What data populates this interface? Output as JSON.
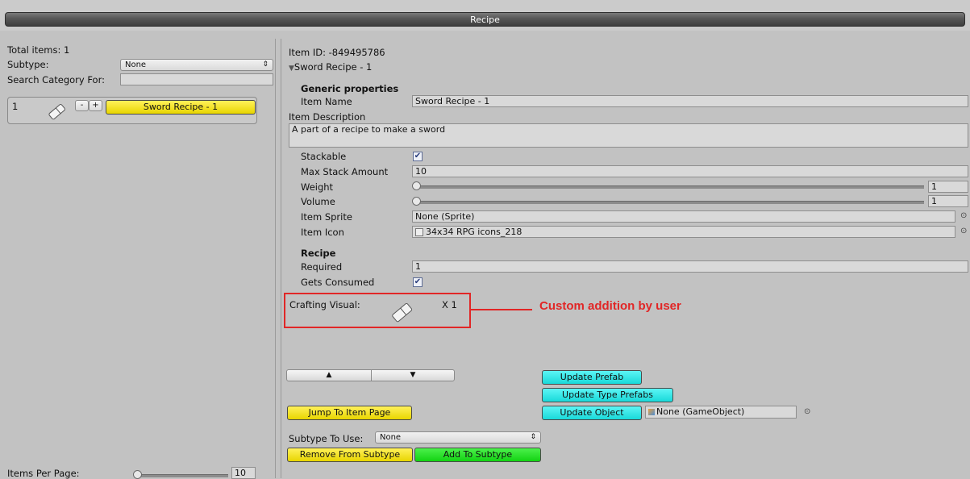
{
  "window": {
    "title": "Recipe"
  },
  "left": {
    "total_items": "Total items: 1",
    "subtype_label": "Subtype:",
    "subtype_value": "None",
    "search_label": "Search Category For:",
    "search_value": "",
    "item": {
      "index": "1",
      "minus": "-",
      "plus": "+",
      "name": "Sword Recipe - 1"
    },
    "items_per_page_label": "Items Per Page:",
    "items_per_page_value": "10",
    "items_per_page_fraction": 0.0
  },
  "right": {
    "item_id": "Item ID: -849495786",
    "foldout": "Sword Recipe - 1",
    "generic_header": "Generic properties",
    "item_name_label": "Item Name",
    "item_name_value": "Sword Recipe - 1",
    "item_desc_label": "Item Description",
    "item_desc_value": "A part of a recipe to make a sword",
    "stackable_label": "Stackable",
    "stackable_checked": true,
    "max_stack_label": "Max Stack Amount",
    "max_stack_value": "10",
    "weight_label": "Weight",
    "weight_value": "1",
    "volume_label": "Volume",
    "volume_value": "1",
    "sprite_label": "Item Sprite",
    "sprite_value": "None (Sprite)",
    "icon_label": "Item Icon",
    "icon_value": "34x34 RPG icons_218",
    "recipe_header": "Recipe",
    "required_label": "Required",
    "required_value": "1",
    "consumed_label": "Gets Consumed",
    "consumed_checked": true,
    "crafting_label": "Crafting Visual:",
    "crafting_mult": "X 1",
    "annotation": "Custom addition by user",
    "up_arrow": "▲",
    "down_arrow": "▼",
    "update_prefab": "Update Prefab",
    "update_type_prefabs": "Update Type Prefabs",
    "update_object": "Update Object",
    "gameobject_value": "None (GameObject)",
    "jump_label": "Jump To Item Page",
    "subtype_use_label": "Subtype To Use:",
    "subtype_use_value": "None",
    "remove_label": "Remove From Subtype",
    "add_label": "Add To Subtype"
  },
  "colors": {
    "yellow_button": "#f0de00",
    "cyan_button": "#22e0e0",
    "green_button": "#20dd20",
    "annotation_red": "#e12626",
    "panel_bg": "#c2c2c2"
  },
  "icons": {
    "item_icon": "eraser-icon",
    "picker": "circle-picker-icon",
    "dropdown_arrow": "updown-arrow-icon",
    "checkmark": "checkmark-icon",
    "gameobject": "cube-icon",
    "sprite_thumb": "sprite-icon"
  }
}
